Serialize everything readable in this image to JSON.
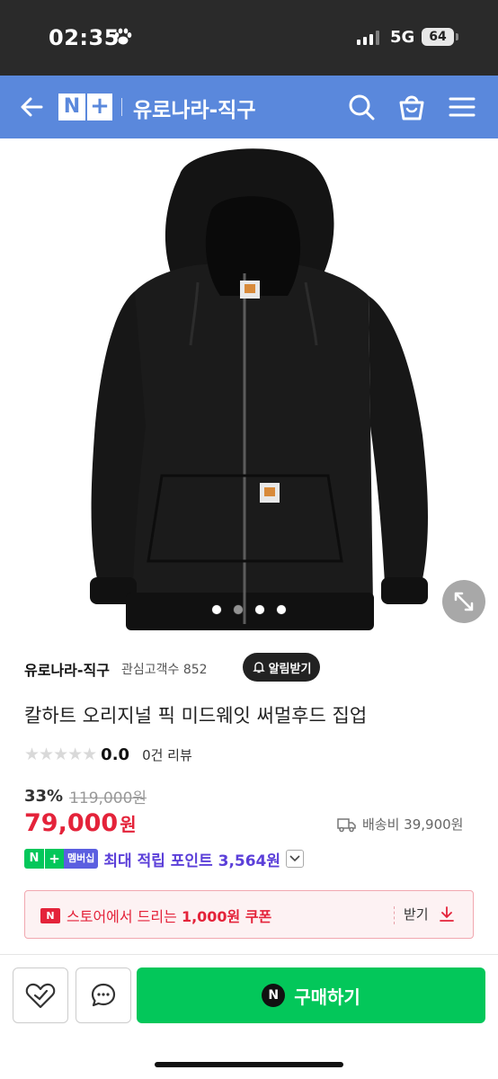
{
  "status_bar": {
    "time": "02:35",
    "network": "5G",
    "battery": "64"
  },
  "nav": {
    "logo_n": "N",
    "logo_plus": "+",
    "title": "유로나라-직구"
  },
  "gallery": {
    "image_subject": "black zip-up hoodie",
    "dot_count": 4,
    "active_dot": 0
  },
  "store": {
    "name": "유로나라-직구",
    "fans": "관심고객수 852",
    "alarm_label": "알림받기"
  },
  "product": {
    "title": "칼하트 오리지널 픽 미드웨잇 써멀후드 집업",
    "stars": "★★★★★",
    "rating": "0.0",
    "review_count": "0건 리뷰",
    "discount_rate": "33%",
    "original_price": "119,000원",
    "sale_price": "79,000",
    "currency": "원",
    "shipping": "배송비 39,900원"
  },
  "membership": {
    "badge_n": "N",
    "badge_plus": "+",
    "badge_label": "멤버십",
    "point_text": "최대 적립 포인트 3,564원"
  },
  "coupon": {
    "badge": "N",
    "text_prefix": "스토어에서 드리는 ",
    "amount": "1,000원 쿠폰",
    "get_label": "받기"
  },
  "bottom_bar": {
    "buy_badge": "N",
    "buy_label": "구매하기"
  },
  "colors": {
    "nav_bg": "#5a88dc",
    "price_red": "#e4233a",
    "naver_green": "#03c75a",
    "point_purple": "#5b3fd9"
  }
}
